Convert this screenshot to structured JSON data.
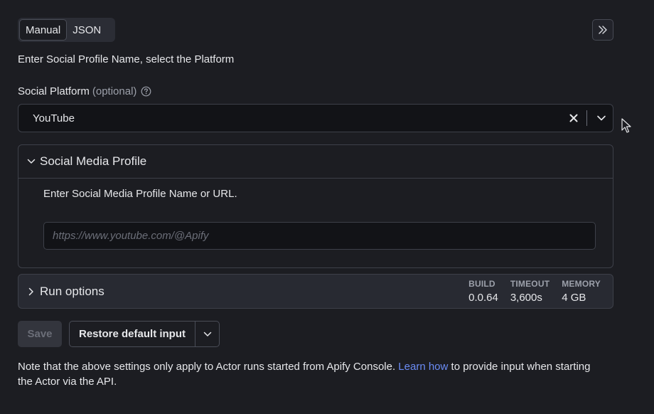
{
  "tabs": [
    {
      "label": "Manual",
      "active": true
    },
    {
      "label": "JSON",
      "active": false
    }
  ],
  "collapse_icon": "double-chevron-right-icon",
  "intro": "Enter Social Profile Name, select the Platform",
  "platform": {
    "label": "Social Platform",
    "optional": "(optional)",
    "value": "YouTube"
  },
  "profile_section": {
    "title": "Social Media Profile",
    "description": "Enter Social Media Profile Name or URL.",
    "placeholder": "https://www.youtube.com/@Apify"
  },
  "run_options": {
    "title": "Run options",
    "build_label": "BUILD",
    "build_value": "0.0.64",
    "timeout_label": "TIMEOUT",
    "timeout_value": "3,600s",
    "memory_label": "MEMORY",
    "memory_value": "4 GB"
  },
  "actions": {
    "save": "Save",
    "restore": "Restore default input"
  },
  "note": {
    "before": "Note that the above settings only apply to Actor runs started from Apify Console. ",
    "link": "Learn how",
    "after": " to provide input when starting the Actor via the API."
  },
  "colors": {
    "background": "#1c1d22",
    "link": "#6b8cf5"
  }
}
